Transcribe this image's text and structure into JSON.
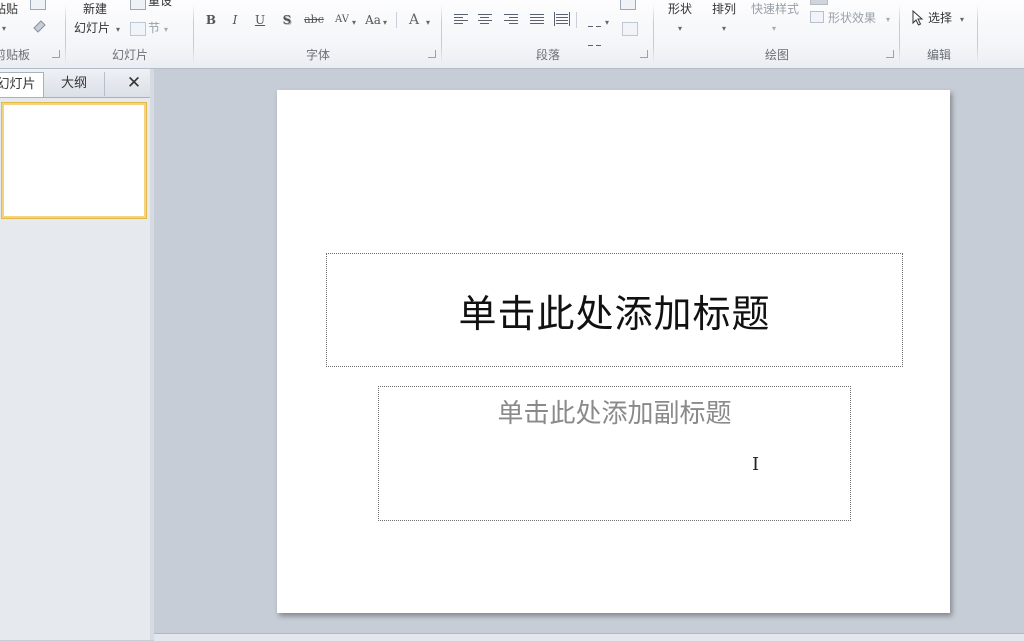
{
  "ribbon": {
    "clipboard": {
      "paste": "粘贴",
      "group": "剪贴板"
    },
    "slides": {
      "new_line1": "新建",
      "new_line2": "幻灯片",
      "reset": "重设",
      "section": "节",
      "group": "幻灯片"
    },
    "font": {
      "group": "字体",
      "bold": "B",
      "italic": "I",
      "underline": "U",
      "shadow": "S",
      "strike": "abc",
      "spacing": "AV",
      "case": "Aa",
      "color": "A"
    },
    "paragraph": {
      "group": "段落"
    },
    "drawing": {
      "shapes": "形状",
      "arrange": "排列",
      "quick_styles": "快速样式",
      "shape_effects": "形状效果",
      "group": "绘图"
    },
    "editing": {
      "select": "选择",
      "group": "编辑"
    }
  },
  "panel": {
    "tab_slides": "幻灯片",
    "tab_outline": "大纲",
    "close": "✕"
  },
  "slide": {
    "title_placeholder": "单击此处添加标题",
    "subtitle_placeholder": "单击此处添加副标题"
  }
}
